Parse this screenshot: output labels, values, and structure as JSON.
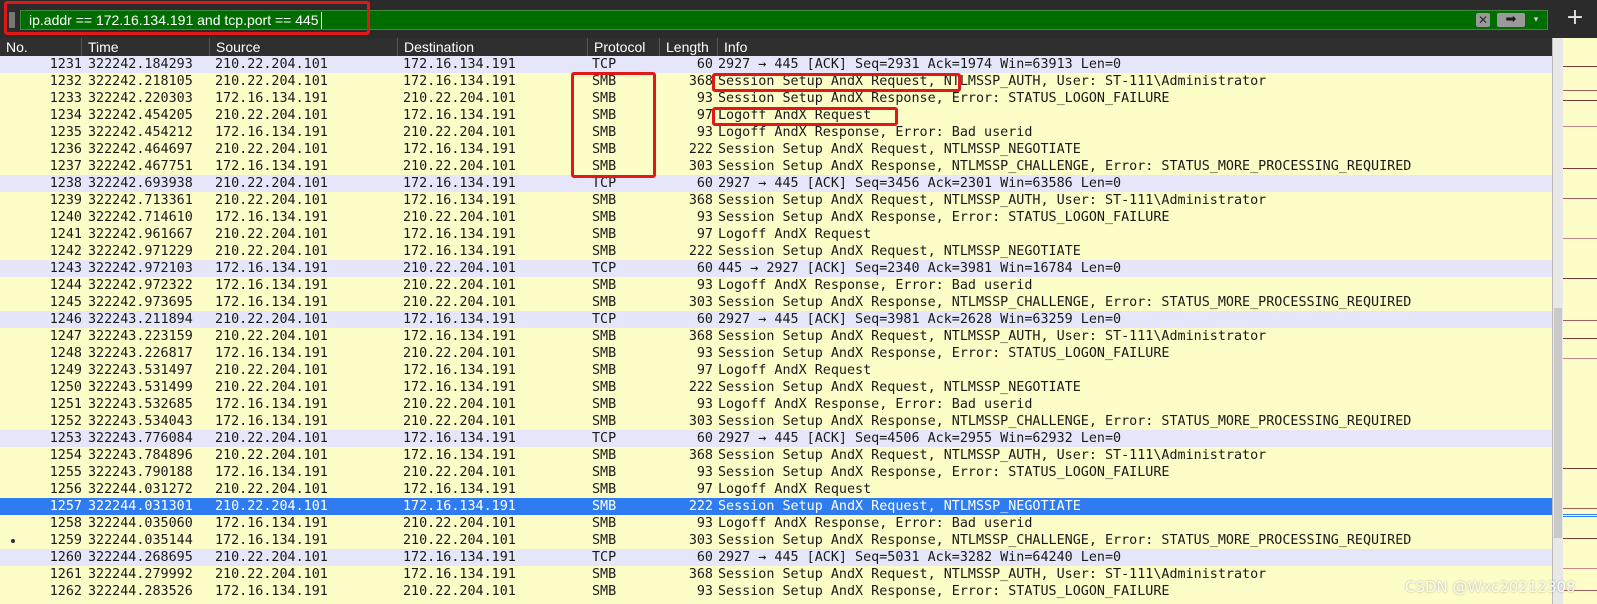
{
  "filter": {
    "value": "ip.addr == 172.16.134.191 and tcp.port == 445",
    "clear_icon": "✕",
    "apply_icon": "➡",
    "dropdown_icon": "▾",
    "add_icon": "+"
  },
  "columns": [
    "No.",
    "Time",
    "Source",
    "Destination",
    "Protocol",
    "Length",
    "Info"
  ],
  "packets": [
    {
      "no": "1231",
      "time": "322242.184293",
      "src": "210.22.204.101",
      "dst": "172.16.134.191",
      "proto": "TCP",
      "len": "60",
      "info": "2927 → 445 [ACK] Seq=2931 Ack=1974 Win=63913 Len=0"
    },
    {
      "no": "1232",
      "time": "322242.218105",
      "src": "210.22.204.101",
      "dst": "172.16.134.191",
      "proto": "SMB",
      "len": "368",
      "info": "Session Setup AndX Request, NTLMSSP_AUTH, User: ST-111\\Administrator"
    },
    {
      "no": "1233",
      "time": "322242.220303",
      "src": "172.16.134.191",
      "dst": "210.22.204.101",
      "proto": "SMB",
      "len": "93",
      "info": "Session Setup AndX Response, Error: STATUS_LOGON_FAILURE"
    },
    {
      "no": "1234",
      "time": "322242.454205",
      "src": "210.22.204.101",
      "dst": "172.16.134.191",
      "proto": "SMB",
      "len": "97",
      "info": "Logoff AndX Request"
    },
    {
      "no": "1235",
      "time": "322242.454212",
      "src": "172.16.134.191",
      "dst": "210.22.204.101",
      "proto": "SMB",
      "len": "93",
      "info": "Logoff AndX Response, Error: Bad userid"
    },
    {
      "no": "1236",
      "time": "322242.464697",
      "src": "210.22.204.101",
      "dst": "172.16.134.191",
      "proto": "SMB",
      "len": "222",
      "info": "Session Setup AndX Request, NTLMSSP_NEGOTIATE"
    },
    {
      "no": "1237",
      "time": "322242.467751",
      "src": "172.16.134.191",
      "dst": "210.22.204.101",
      "proto": "SMB",
      "len": "303",
      "info": "Session Setup AndX Response, NTLMSSP_CHALLENGE, Error: STATUS_MORE_PROCESSING_REQUIRED"
    },
    {
      "no": "1238",
      "time": "322242.693938",
      "src": "210.22.204.101",
      "dst": "172.16.134.191",
      "proto": "TCP",
      "len": "60",
      "info": "2927 → 445 [ACK] Seq=3456 Ack=2301 Win=63586 Len=0"
    },
    {
      "no": "1239",
      "time": "322242.713361",
      "src": "210.22.204.101",
      "dst": "172.16.134.191",
      "proto": "SMB",
      "len": "368",
      "info": "Session Setup AndX Request, NTLMSSP_AUTH, User: ST-111\\Administrator"
    },
    {
      "no": "1240",
      "time": "322242.714610",
      "src": "172.16.134.191",
      "dst": "210.22.204.101",
      "proto": "SMB",
      "len": "93",
      "info": "Session Setup AndX Response, Error: STATUS_LOGON_FAILURE"
    },
    {
      "no": "1241",
      "time": "322242.961667",
      "src": "210.22.204.101",
      "dst": "172.16.134.191",
      "proto": "SMB",
      "len": "97",
      "info": "Logoff AndX Request"
    },
    {
      "no": "1242",
      "time": "322242.971229",
      "src": "210.22.204.101",
      "dst": "172.16.134.191",
      "proto": "SMB",
      "len": "222",
      "info": "Session Setup AndX Request, NTLMSSP_NEGOTIATE"
    },
    {
      "no": "1243",
      "time": "322242.972103",
      "src": "172.16.134.191",
      "dst": "210.22.204.101",
      "proto": "TCP",
      "len": "60",
      "info": "445 → 2927 [ACK] Seq=2340 Ack=3981 Win=16784 Len=0"
    },
    {
      "no": "1244",
      "time": "322242.972322",
      "src": "172.16.134.191",
      "dst": "210.22.204.101",
      "proto": "SMB",
      "len": "93",
      "info": "Logoff AndX Response, Error: Bad userid"
    },
    {
      "no": "1245",
      "time": "322242.973695",
      "src": "172.16.134.191",
      "dst": "210.22.204.101",
      "proto": "SMB",
      "len": "303",
      "info": "Session Setup AndX Response, NTLMSSP_CHALLENGE, Error: STATUS_MORE_PROCESSING_REQUIRED"
    },
    {
      "no": "1246",
      "time": "322243.211894",
      "src": "210.22.204.101",
      "dst": "172.16.134.191",
      "proto": "TCP",
      "len": "60",
      "info": "2927 → 445 [ACK] Seq=3981 Ack=2628 Win=63259 Len=0"
    },
    {
      "no": "1247",
      "time": "322243.223159",
      "src": "210.22.204.101",
      "dst": "172.16.134.191",
      "proto": "SMB",
      "len": "368",
      "info": "Session Setup AndX Request, NTLMSSP_AUTH, User: ST-111\\Administrator"
    },
    {
      "no": "1248",
      "time": "322243.226817",
      "src": "172.16.134.191",
      "dst": "210.22.204.101",
      "proto": "SMB",
      "len": "93",
      "info": "Session Setup AndX Response, Error: STATUS_LOGON_FAILURE"
    },
    {
      "no": "1249",
      "time": "322243.531497",
      "src": "210.22.204.101",
      "dst": "172.16.134.191",
      "proto": "SMB",
      "len": "97",
      "info": "Logoff AndX Request"
    },
    {
      "no": "1250",
      "time": "322243.531499",
      "src": "210.22.204.101",
      "dst": "172.16.134.191",
      "proto": "SMB",
      "len": "222",
      "info": "Session Setup AndX Request, NTLMSSP_NEGOTIATE"
    },
    {
      "no": "1251",
      "time": "322243.532685",
      "src": "172.16.134.191",
      "dst": "210.22.204.101",
      "proto": "SMB",
      "len": "93",
      "info": "Logoff AndX Response, Error: Bad userid"
    },
    {
      "no": "1252",
      "time": "322243.534043",
      "src": "172.16.134.191",
      "dst": "210.22.204.101",
      "proto": "SMB",
      "len": "303",
      "info": "Session Setup AndX Response, NTLMSSP_CHALLENGE, Error: STATUS_MORE_PROCESSING_REQUIRED"
    },
    {
      "no": "1253",
      "time": "322243.776084",
      "src": "210.22.204.101",
      "dst": "172.16.134.191",
      "proto": "TCP",
      "len": "60",
      "info": "2927 → 445 [ACK] Seq=4506 Ack=2955 Win=62932 Len=0"
    },
    {
      "no": "1254",
      "time": "322243.784896",
      "src": "210.22.204.101",
      "dst": "172.16.134.191",
      "proto": "SMB",
      "len": "368",
      "info": "Session Setup AndX Request, NTLMSSP_AUTH, User: ST-111\\Administrator"
    },
    {
      "no": "1255",
      "time": "322243.790188",
      "src": "172.16.134.191",
      "dst": "210.22.204.101",
      "proto": "SMB",
      "len": "93",
      "info": "Session Setup AndX Response, Error: STATUS_LOGON_FAILURE"
    },
    {
      "no": "1256",
      "time": "322244.031272",
      "src": "210.22.204.101",
      "dst": "172.16.134.191",
      "proto": "SMB",
      "len": "97",
      "info": "Logoff AndX Request"
    },
    {
      "no": "1257",
      "time": "322244.031301",
      "src": "210.22.204.101",
      "dst": "172.16.134.191",
      "proto": "SMB",
      "len": "222",
      "info": "Session Setup AndX Request, NTLMSSP_NEGOTIATE",
      "selected": true
    },
    {
      "no": "1258",
      "time": "322244.035060",
      "src": "172.16.134.191",
      "dst": "210.22.204.101",
      "proto": "SMB",
      "len": "93",
      "info": "Logoff AndX Response, Error: Bad userid"
    },
    {
      "no": "1259",
      "time": "322244.035144",
      "src": "172.16.134.191",
      "dst": "210.22.204.101",
      "proto": "SMB",
      "len": "303",
      "info": "Session Setup AndX Response, NTLMSSP_CHALLENGE, Error: STATUS_MORE_PROCESSING_REQUIRED"
    },
    {
      "no": "1260",
      "time": "322244.268695",
      "src": "210.22.204.101",
      "dst": "172.16.134.191",
      "proto": "TCP",
      "len": "60",
      "info": "2927 → 445 [ACK] Seq=5031 Ack=3282 Win=64240 Len=0"
    },
    {
      "no": "1261",
      "time": "322244.279992",
      "src": "210.22.204.101",
      "dst": "172.16.134.191",
      "proto": "SMB",
      "len": "368",
      "info": "Session Setup AndX Request, NTLMSSP_AUTH, User: ST-111\\Administrator"
    },
    {
      "no": "1262",
      "time": "322244.283526",
      "src": "172.16.134.191",
      "dst": "210.22.204.101",
      "proto": "SMB",
      "len": "93",
      "info": "Session Setup AndX Response, Error: STATUS_LOGON_FAILURE"
    }
  ],
  "colors": {
    "smb_row": "#fdfdc8",
    "tcp_row": "#e6e6fa",
    "selected_row": "#2f7cf0",
    "filter_valid": "#006d00",
    "annotation": "#e01818"
  },
  "watermark": "CSDN @Wxc20212308"
}
